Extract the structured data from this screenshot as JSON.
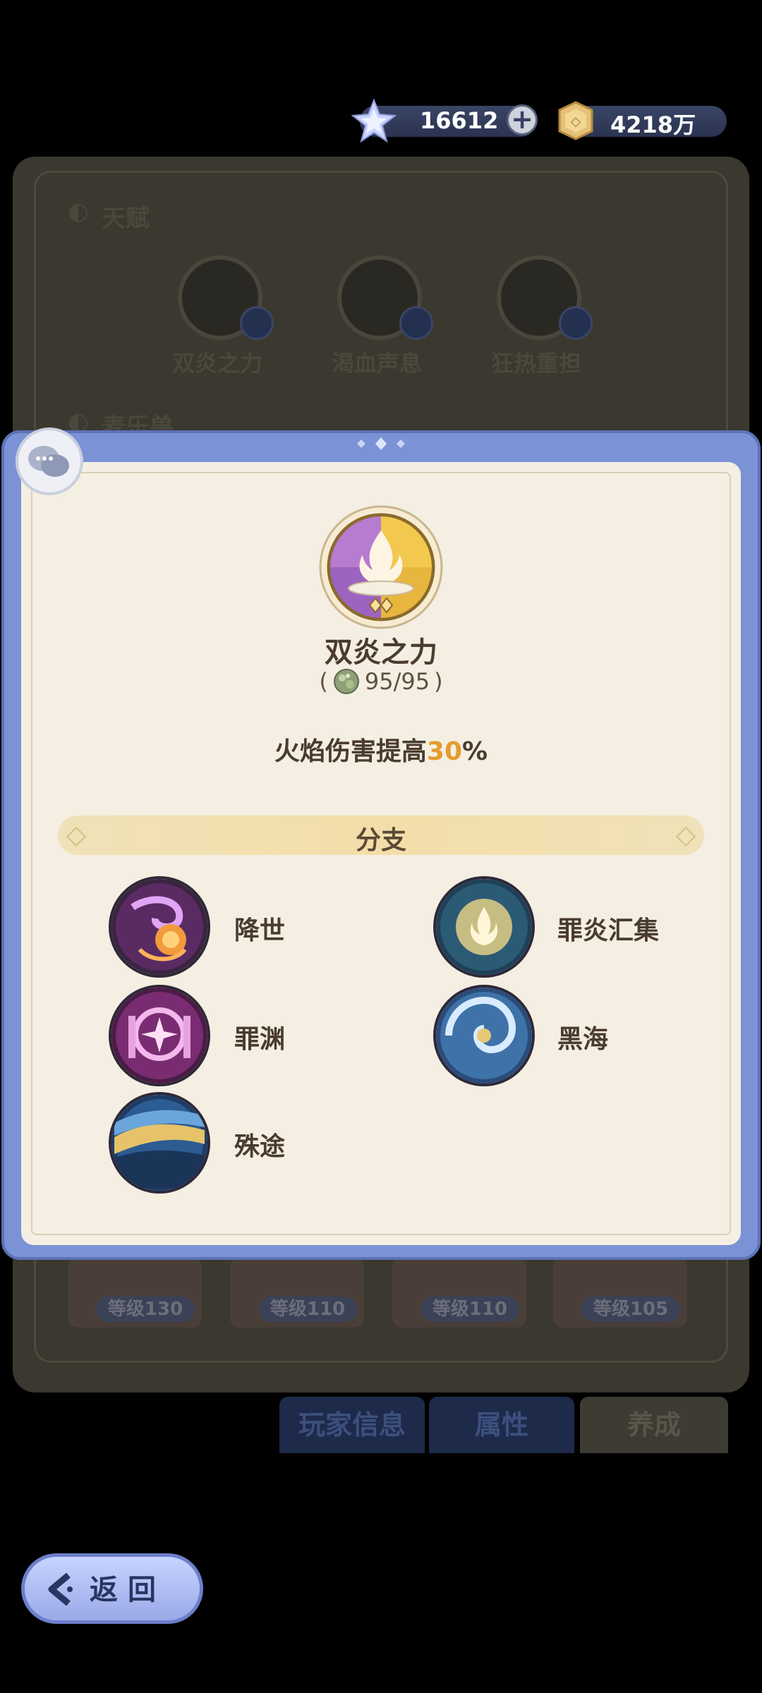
{
  "currency": {
    "gems": "16612",
    "gold": "4218万"
  },
  "background": {
    "talent_section_title": "天赋",
    "talents": [
      "双炎之力",
      "渴血声息",
      "狂热重担"
    ],
    "pet_section_title": "麦乐兽",
    "pet_levels": [
      "等级130",
      "等级110",
      "等级110",
      "等级105"
    ],
    "tabs": {
      "player_info": "玩家信息",
      "attributes": "属性",
      "training": "养成"
    }
  },
  "popup": {
    "talent_name": "双炎之力",
    "cost_open": "(",
    "cost_value": "95/95",
    "cost_close": ")",
    "description_prefix": "火焰伤害提高",
    "description_highlight": "30",
    "description_suffix": "%",
    "branch_title": "分支",
    "branches": [
      {
        "name": "降世"
      },
      {
        "name": "罪炎汇集"
      },
      {
        "name": "罪渊"
      },
      {
        "name": "黑海"
      },
      {
        "name": "殊途"
      }
    ]
  },
  "back_button": {
    "label": "返回"
  }
}
